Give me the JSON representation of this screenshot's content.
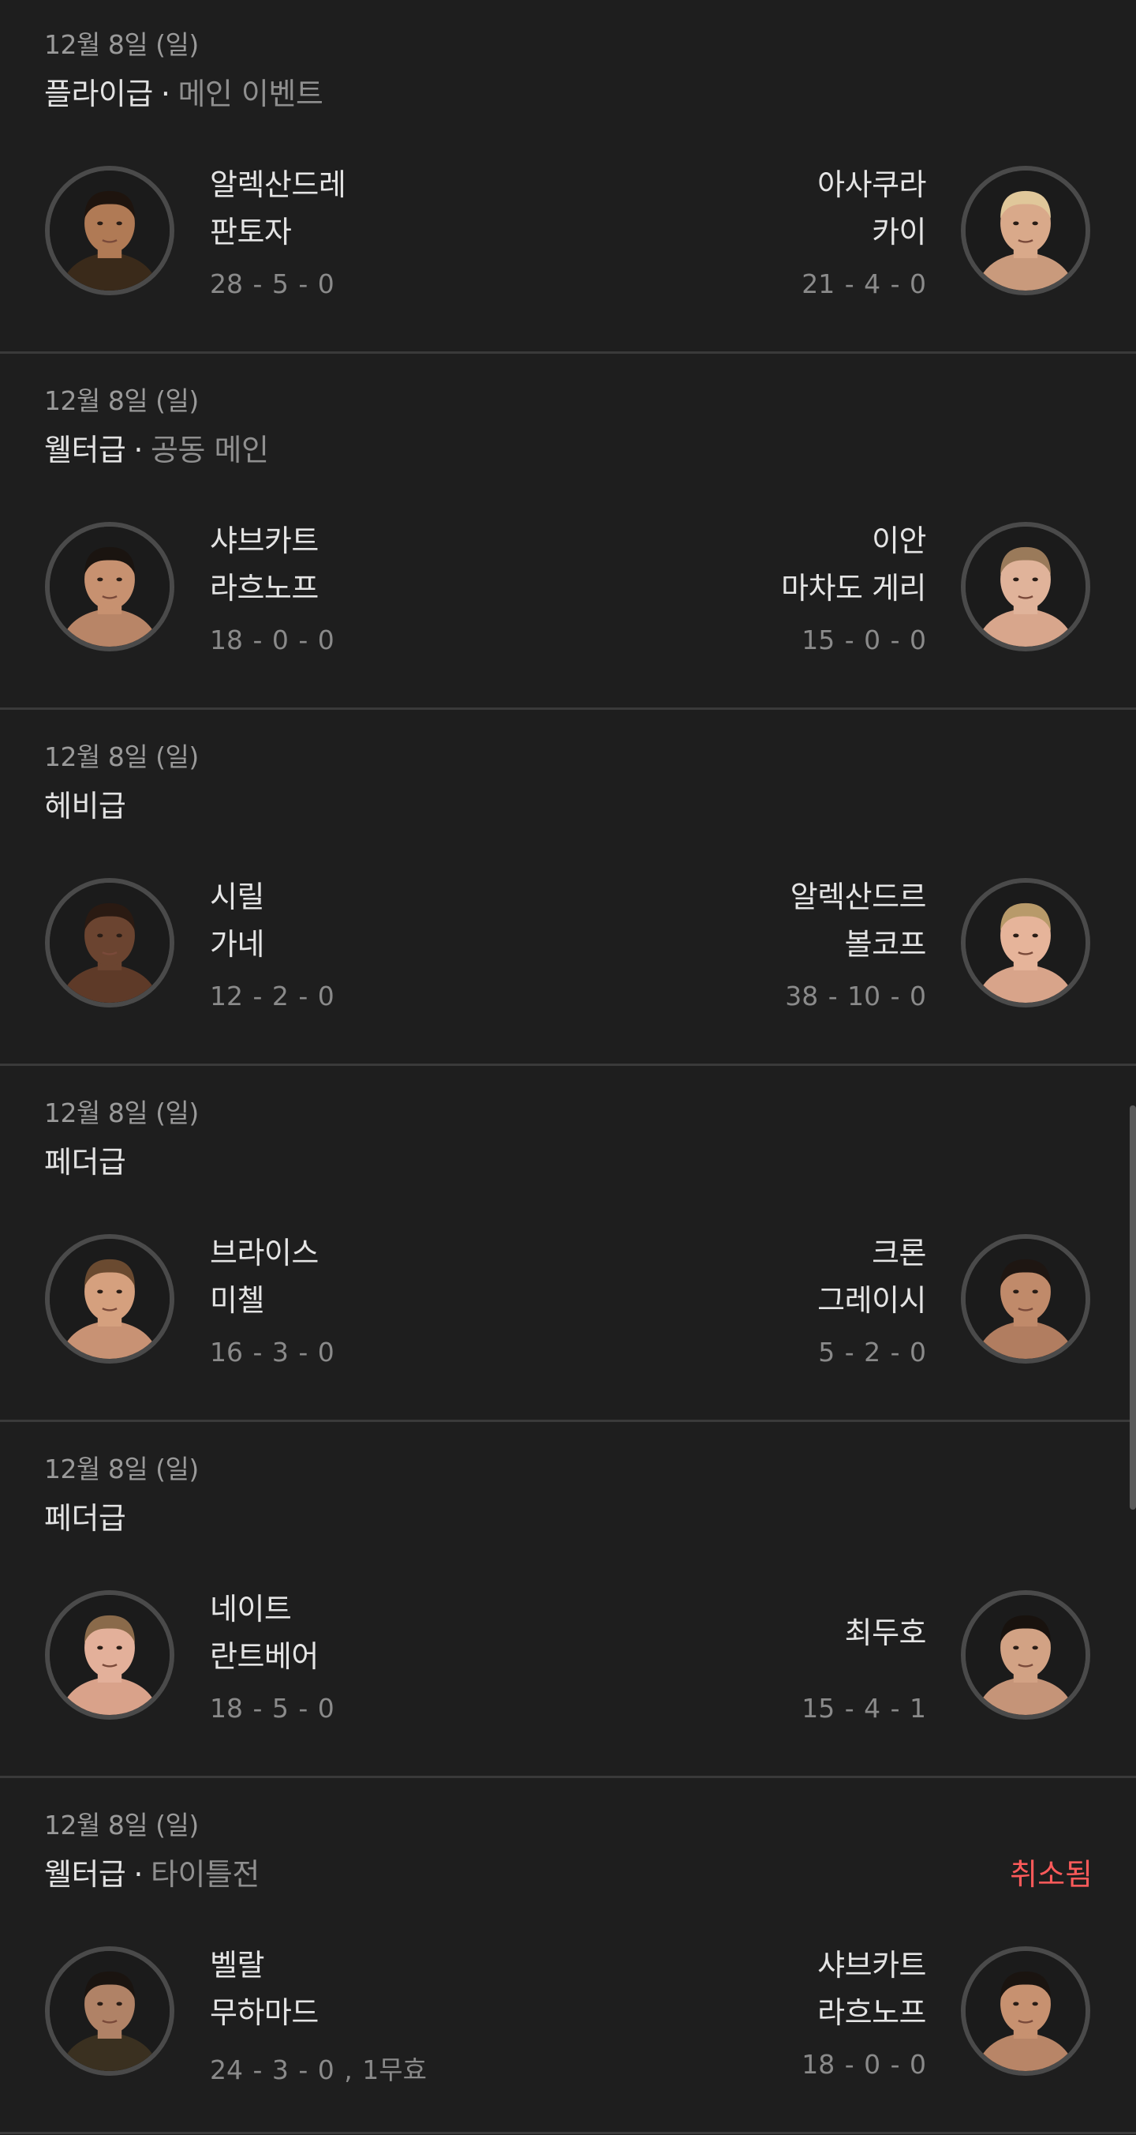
{
  "bouts": [
    {
      "date": "12월 8일 (일)",
      "division": "플라이급",
      "subtitle": "메인 이벤트",
      "status": "",
      "red": {
        "name_line1": "알렉산드레",
        "name_line2": "판토자",
        "record": "28 - 5 - 0",
        "skin": "#b07a55",
        "hair": "#1e140e",
        "shirt": "#3a2a1a"
      },
      "blue": {
        "name_line1": "아사쿠라",
        "name_line2": "카이",
        "record": "21 - 4 - 0",
        "skin": "#d9a98a",
        "hair": "#e0c79a",
        "shirt": "#c99a7c"
      }
    },
    {
      "date": "12월 8일 (일)",
      "division": "웰터급",
      "subtitle": "공동 메인",
      "status": "",
      "red": {
        "name_line1": "샤브카트",
        "name_line2": "라흐노프",
        "record": "18 - 0 - 0",
        "skin": "#c79170",
        "hair": "#1a1410",
        "shirt": "#b88567"
      },
      "blue": {
        "name_line1": "이안",
        "name_line2": "마차도 게리",
        "record": "15 - 0 - 0",
        "skin": "#e0b39a",
        "hair": "#9a7a5a",
        "shirt": "#d8a68c"
      }
    },
    {
      "date": "12월 8일 (일)",
      "division": "헤비급",
      "subtitle": "",
      "status": "",
      "red": {
        "name_line1": "시릴",
        "name_line2": "가네",
        "record": "12 - 2 - 0",
        "skin": "#6b4430",
        "hair": "#2a1a12",
        "shirt": "#5e3a28"
      },
      "blue": {
        "name_line1": "알렉산드르",
        "name_line2": "볼코프",
        "record": "38 - 10 - 0",
        "skin": "#e6b49a",
        "hair": "#b89a6a",
        "shirt": "#d8a48a"
      }
    },
    {
      "date": "12월 8일 (일)",
      "division": "페더급",
      "subtitle": "",
      "status": "",
      "red": {
        "name_line1": "브라이스",
        "name_line2": "미첼",
        "record": "16 - 3 - 0",
        "skin": "#d5a07e",
        "hair": "#6a4a30",
        "shirt": "#c89274"
      },
      "blue": {
        "name_line1": "크론",
        "name_line2": "그레이시",
        "record": "5 - 2 - 0",
        "skin": "#c08a6a",
        "hair": "#1e1612",
        "shirt": "#b17d60"
      }
    },
    {
      "date": "12월 8일 (일)",
      "division": "페더급",
      "subtitle": "",
      "status": "",
      "red": {
        "name_line1": "네이트",
        "name_line2": "란트베어",
        "record": "18 - 5 - 0",
        "skin": "#e3b09a",
        "hair": "#8a6a4a",
        "shirt": "#d9a28a"
      },
      "blue": {
        "name_line1": "최두호",
        "name_line2": "",
        "record": "15 - 4 - 1",
        "skin": "#d2a284",
        "hair": "#18120e",
        "shirt": "#c59478"
      }
    },
    {
      "date": "12월 8일 (일)",
      "division": "웰터급",
      "subtitle": "타이틀전",
      "status": "취소됨",
      "red": {
        "name_line1": "벨랄",
        "name_line2": "무하마드",
        "record": "24 - 3 - 0 , 1무효",
        "skin": "#b08266",
        "hair": "#1a1410",
        "shirt": "#3a3020"
      },
      "blue": {
        "name_line1": "샤브카트",
        "name_line2": "라흐노프",
        "record": "18 - 0 - 0",
        "skin": "#c79170",
        "hair": "#1a1410",
        "shirt": "#b88567"
      }
    }
  ]
}
